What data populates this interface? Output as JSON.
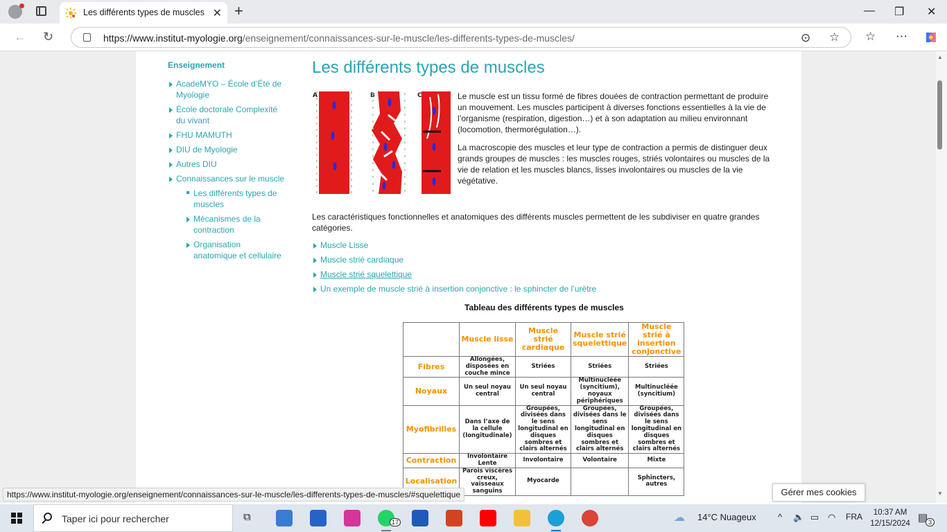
{
  "browser": {
    "tab_title": "Les différents types de muscles - I",
    "address_host": "https://www.institut-myologie.org",
    "address_path": "/enseignement/connaissances-sur-le-muscle/les-differents-types-de-muscles/"
  },
  "sidebar": {
    "title": "Enseignement",
    "items": [
      {
        "label": "AcadeMYO – École d’Été de Myologie"
      },
      {
        "label": "École doctorale Complexité du vivant"
      },
      {
        "label": "FHU MAMUTH"
      },
      {
        "label": "DIU de Myologie"
      },
      {
        "label": "Autres DIU"
      },
      {
        "label": "Connaissances sur le muscle"
      }
    ],
    "subitems": [
      {
        "label": "Les différents types de muscles"
      },
      {
        "label": "Mécanismes de la contraction"
      },
      {
        "label": "Organisation anatomique et cellulaire"
      }
    ]
  },
  "article": {
    "title": "Les différents types de muscles",
    "figure_labels": [
      "A",
      "B",
      "C"
    ],
    "p1": "Le muscle est un tissu formé de fibres douées de contraction permettant de produire un mouvement. Les muscles participent à diverses fonctions essentielles à la vie de l’organisme (respiration, digestion…) et à son adaptation au milieu environnant (locomotion, thermorégulation…).",
    "p2": "La macroscopie des muscles et leur type de contraction a permis de distinguer deux grands groupes de muscles : les muscles rouges, striés volontaires ou muscles de la vie de relation et les muscles blancs, lisses involontaires ou muscles de la vie végétative.",
    "p3": "Les caractéristiques fonctionnelles et anatomiques des différents muscles permettent de les subdiviser en quatre grandes catégories.",
    "links": [
      "Muscle Lisse",
      "Muscle strié cardiaque",
      "Muscle strié squelettique",
      "Un exemple de muscle strié à insertion conjonctive : le sphincter de l’urètre"
    ],
    "table_title": "Tableau des différents types de muscles"
  },
  "table": {
    "headers": [
      "",
      "Muscle lisse",
      "Muscle strié cardiaque",
      "Muscle strié squelettique",
      "Muscle strié à insertion conjonctive"
    ],
    "rows": [
      [
        "Fibres",
        "Allongées, disposées en couche mince",
        "Striées",
        "Striées",
        "Striées"
      ],
      [
        "Noyaux",
        "Un seul noyau central",
        "Un seul noyau central",
        "Multinucléée (syncitium), noyaux périphériques",
        "Multinucléée (syncitium)"
      ],
      [
        "Myofibrilles",
        "Dans l’axe de la cellule (longitudinale)",
        "Groupées, divisées dans le sens longitudinal en disques sombres et clairs alternés",
        "Groupées, divisées dans le sens longitudinal en disques sombres et clairs alternés",
        "Groupées, divisées dans le sens longitudinal en disques sombres et clairs alternés"
      ],
      [
        "Contraction",
        "Involontaire Lente",
        "Involontaire",
        "Volontaire",
        "Mixte"
      ],
      [
        "Localisation",
        "Parois viscères creux, vaisseaux sanguins",
        "Myocarde",
        "",
        "Sphincters, autres"
      ]
    ]
  },
  "status_url": "https://www.institut-myologie.org/enseignement/connaissances-sur-le-muscle/les-differents-types-de-muscles/#squelettique",
  "cookies_button": "Gérer mes cookies",
  "taskbar": {
    "search_placeholder": "Taper ici pour rechercher",
    "weather": "14°C  Nuageux",
    "lang": "FRA",
    "time": "10:37 AM",
    "date": "12/15/2024",
    "whatsapp_badge": "17",
    "notif_badge": "3"
  },
  "colors": {
    "accent": "#2aa6b1",
    "table_header": "#f39200",
    "muscle_red": "#e11b1b"
  }
}
